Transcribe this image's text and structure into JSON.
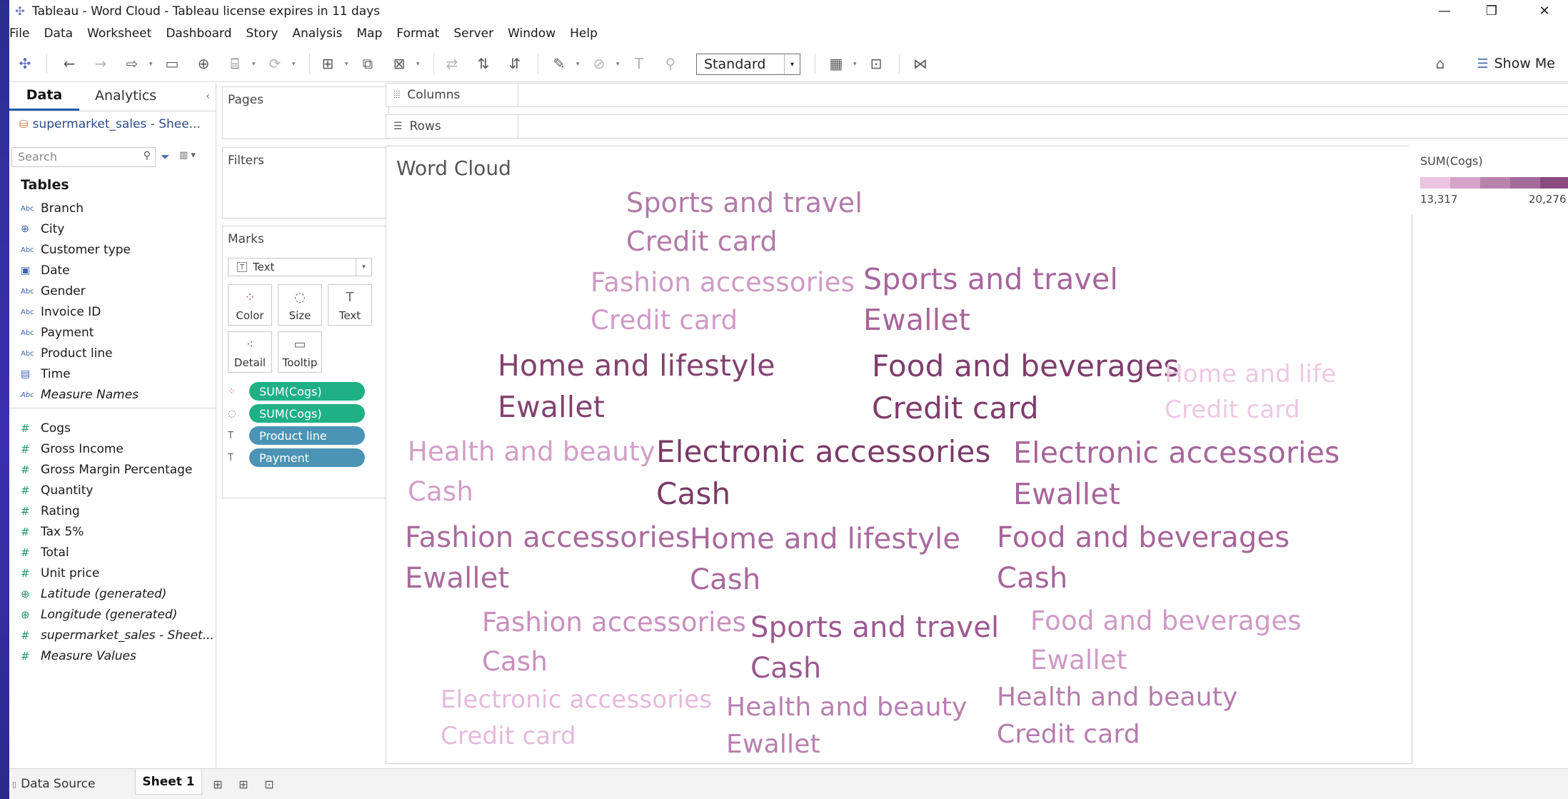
{
  "window": {
    "title": "Tableau - Word Cloud - Tableau license expires in 11 days",
    "minimize": "—",
    "maximize": "❐",
    "close": "✕"
  },
  "menu": [
    "File",
    "Data",
    "Worksheet",
    "Dashboard",
    "Story",
    "Analysis",
    "Map",
    "Format",
    "Server",
    "Window",
    "Help"
  ],
  "toolbar": {
    "fit_select": "Standard",
    "show_me": "Show Me"
  },
  "data_pane": {
    "tabs": [
      "Data",
      "Analytics"
    ],
    "datasource": "supermarket_sales - Shee...",
    "search_placeholder": "Search",
    "tables_heading": "Tables",
    "dimensions": [
      {
        "type": "Abc",
        "name": "Branch"
      },
      {
        "type": "geo",
        "name": "City"
      },
      {
        "type": "Abc",
        "name": "Customer type"
      },
      {
        "type": "date",
        "name": "Date"
      },
      {
        "type": "Abc",
        "name": "Gender"
      },
      {
        "type": "Abc",
        "name": "Invoice ID"
      },
      {
        "type": "Abc",
        "name": "Payment"
      },
      {
        "type": "Abc",
        "name": "Product line"
      },
      {
        "type": "date",
        "name": "Time"
      },
      {
        "type": "Abc",
        "name": "Measure Names"
      }
    ],
    "measures": [
      {
        "type": "#",
        "name": "Cogs"
      },
      {
        "type": "#",
        "name": "Gross Income"
      },
      {
        "type": "#",
        "name": "Gross Margin Percentage"
      },
      {
        "type": "#",
        "name": "Quantity"
      },
      {
        "type": "#",
        "name": "Rating"
      },
      {
        "type": "#",
        "name": "Tax 5%"
      },
      {
        "type": "#",
        "name": "Total"
      },
      {
        "type": "#",
        "name": "Unit price"
      },
      {
        "type": "geo",
        "name": "Latitude (generated)"
      },
      {
        "type": "geo",
        "name": "Longitude (generated)"
      },
      {
        "type": "#",
        "name": "supermarket_sales - Sheet..."
      },
      {
        "type": "#",
        "name": "Measure Values"
      }
    ]
  },
  "cards": {
    "pages": "Pages",
    "filters": "Filters",
    "marks": "Marks",
    "mark_type": "Text",
    "buttons": [
      "Color",
      "Size",
      "Text",
      "Detail",
      "Tooltip"
    ],
    "pills": [
      "SUM(Cogs)",
      "SUM(Cogs)",
      "Product line",
      "Payment"
    ]
  },
  "shelves": {
    "columns": "Columns",
    "rows": "Rows"
  },
  "viz": {
    "title": "Word Cloud",
    "words": [
      {
        "line1": "Sports and travel",
        "line2": "Credit card",
        "color": "#b27aa8"
      },
      {
        "line1": "Fashion accessories",
        "line2": "Credit card",
        "color": "#cf9ac6"
      },
      {
        "line1": "Sports and travel",
        "line2": "Ewallet",
        "color": "#a7649a"
      },
      {
        "line1": "Home and lifestyle",
        "line2": "Ewallet",
        "color": "#83426f"
      },
      {
        "line1": "Food and beverages",
        "line2": "Credit card",
        "color": "#7f3c6b"
      },
      {
        "line1": "Home and life",
        "line2": "Credit card",
        "color": "#edc8e3"
      },
      {
        "line1": "Health and beauty",
        "line2": "Cash",
        "color": "#d29dc8"
      },
      {
        "line1": "Electronic accessories",
        "line2": "Cash",
        "color": "#7b3a68"
      },
      {
        "line1": "Electronic accessories",
        "line2": "Ewallet",
        "color": "#a7649a"
      },
      {
        "line1": "Fashion accessories",
        "line2": "Ewallet",
        "color": "#a86b9c"
      },
      {
        "line1": "Home and lifestyle",
        "line2": "Cash",
        "color": "#a9699e"
      },
      {
        "line1": "Food and beverages",
        "line2": "Cash",
        "color": "#a7649a"
      },
      {
        "line1": "Fashion accessories",
        "line2": "Cash",
        "color": "#c88fbe"
      },
      {
        "line1": "Sports and travel",
        "line2": "Cash",
        "color": "#9c5890"
      },
      {
        "line1": "Food and beverages",
        "line2": "Ewallet",
        "color": "#cf9ac6"
      },
      {
        "line1": "Electronic accessories",
        "line2": "Credit card",
        "color": "#e5b9dc"
      },
      {
        "line1": "Health and beauty",
        "line2": "Ewallet",
        "color": "#b87fb0"
      },
      {
        "line1": "Health and beauty",
        "line2": "Credit card",
        "color": "#b57cad"
      }
    ]
  },
  "legend": {
    "title": "SUM(Cogs)",
    "min": "13,317",
    "max": "20,276",
    "colors": [
      "#ebc4e3",
      "#d3a3ca",
      "#b883ad",
      "#a46b9b",
      "#8a4c7e"
    ]
  },
  "bottom": {
    "data_source": "Data Source",
    "sheet": "Sheet 1"
  }
}
